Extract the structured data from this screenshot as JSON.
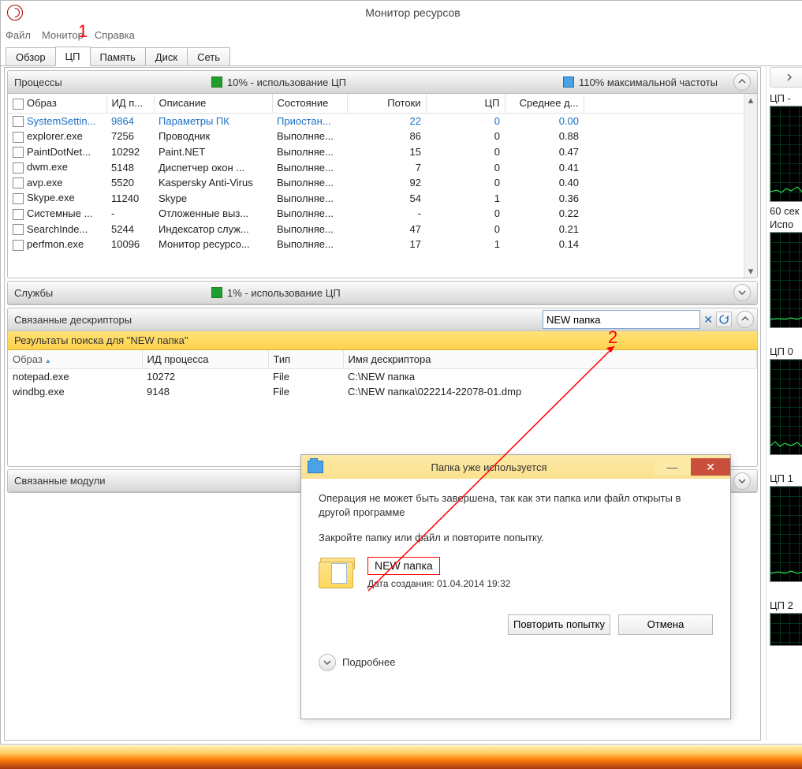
{
  "window": {
    "title": "Монитор ресурсов"
  },
  "menu": {
    "file": "Файл",
    "monitor": "Монитор",
    "help": "Справка"
  },
  "annotations": {
    "one": "1",
    "two": "2"
  },
  "tabs": {
    "overview": "Обзор",
    "cpu": "ЦП",
    "memory": "Память",
    "disk": "Диск",
    "network": "Сеть"
  },
  "processes": {
    "title": "Процессы",
    "legend_cpu": "10% - использование ЦП",
    "legend_freq": "110% максимальной частоты",
    "cols": {
      "image": "Образ",
      "pid": "ИД п...",
      "desc": "Описание",
      "status": "Состояние",
      "threads": "Потоки",
      "cpu": "ЦП",
      "avg": "Среднее д..."
    },
    "rows": [
      {
        "image": "SystemSettin...",
        "pid": "9864",
        "desc": "Параметры ПК",
        "status": "Приостан...",
        "threads": "22",
        "cpu": "0",
        "avg": "0.00",
        "sel": true
      },
      {
        "image": "explorer.exe",
        "pid": "7256",
        "desc": "Проводник",
        "status": "Выполняе...",
        "threads": "86",
        "cpu": "0",
        "avg": "0.88"
      },
      {
        "image": "PaintDotNet...",
        "pid": "10292",
        "desc": "Paint.NET",
        "status": "Выполняе...",
        "threads": "15",
        "cpu": "0",
        "avg": "0.47"
      },
      {
        "image": "dwm.exe",
        "pid": "5148",
        "desc": "Диспетчер окон ...",
        "status": "Выполняе...",
        "threads": "7",
        "cpu": "0",
        "avg": "0.41"
      },
      {
        "image": "avp.exe",
        "pid": "5520",
        "desc": "Kaspersky Anti-Virus",
        "status": "Выполняе...",
        "threads": "92",
        "cpu": "0",
        "avg": "0.40"
      },
      {
        "image": "Skype.exe",
        "pid": "11240",
        "desc": "Skype",
        "status": "Выполняе...",
        "threads": "54",
        "cpu": "1",
        "avg": "0.36"
      },
      {
        "image": "Системные ...",
        "pid": "-",
        "desc": "Отложенные выз...",
        "status": "Выполняе...",
        "threads": "-",
        "cpu": "0",
        "avg": "0.22"
      },
      {
        "image": "SearchInde...",
        "pid": "5244",
        "desc": "Индексатор служ...",
        "status": "Выполняе...",
        "threads": "47",
        "cpu": "0",
        "avg": "0.21"
      },
      {
        "image": "perfmon.exe",
        "pid": "10096",
        "desc": "Монитор ресурсо...",
        "status": "Выполняе...",
        "threads": "17",
        "cpu": "1",
        "avg": "0.14"
      }
    ]
  },
  "services": {
    "title": "Службы",
    "legend": "1% - использование ЦП"
  },
  "handles": {
    "title": "Связанные дескрипторы",
    "search_value": "NEW папка",
    "results_label": "Результаты поиска для \"NEW папка\"",
    "cols": {
      "image": "Образ",
      "pid": "ИД процесса",
      "type": "Тип",
      "name": "Имя дескриптора"
    },
    "rows": [
      {
        "image": "notepad.exe",
        "pid": "10272",
        "type": "File",
        "name": "C:\\NEW папка"
      },
      {
        "image": "windbg.exe",
        "pid": "9148",
        "type": "File",
        "name": "C:\\NEW папка\\022214-22078-01.dmp"
      }
    ]
  },
  "modules": {
    "title": "Связанные модули"
  },
  "dialog": {
    "title": "Папка уже используется",
    "line1": "Операция не может быть завершена, так как эти папка или файл открыты в другой программе",
    "line2": "Закройте папку или файл и повторите попытку.",
    "file_name": "NEW папка",
    "file_date": "Дата создания: 01.04.2014 19:32",
    "retry": "Повторить попытку",
    "cancel": "Отмена",
    "more": "Подробнее"
  },
  "right": {
    "head": "ЦП -",
    "l60": "60 сек",
    "lusage": "Испо",
    "c0": "ЦП 0",
    "c1": "ЦП 1",
    "c2": "ЦП 2"
  }
}
